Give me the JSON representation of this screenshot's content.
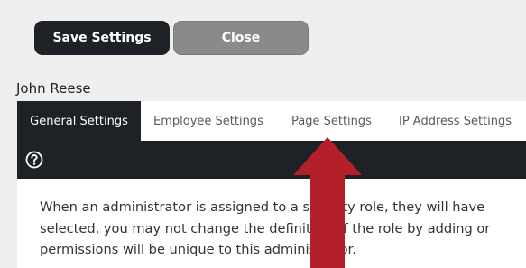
{
  "toolbar": {
    "save_label": "Save Settings",
    "close_label": "Close"
  },
  "user": {
    "name": "John Reese"
  },
  "tabs": [
    {
      "label": "General Settings",
      "active": true
    },
    {
      "label": "Employee Settings",
      "active": false
    },
    {
      "label": "Page Settings",
      "active": false
    },
    {
      "label": "IP Address Settings",
      "active": false
    }
  ],
  "icons": {
    "help": "question-circle-icon",
    "annotation": "red-up-arrow"
  },
  "description": {
    "lines": [
      "When an administrator is assigned to a security role, they will have",
      "selected, you may not change the definition of the role by adding or",
      "permissions will be unique to this administrator."
    ]
  },
  "colors": {
    "dark": "#1e2226",
    "close_button": "#8a8a8a",
    "background": "#efefef",
    "arrow": "#b3202a"
  }
}
